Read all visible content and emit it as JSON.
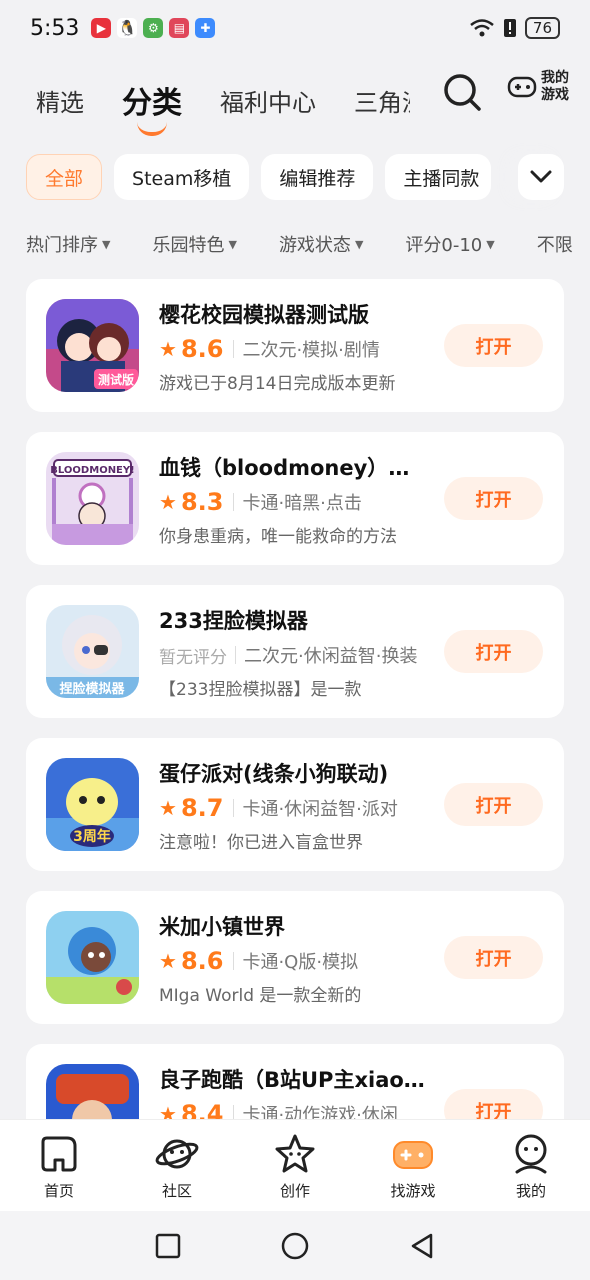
{
  "status_bar": {
    "time": "5:53",
    "battery": "76",
    "notification_icons": [
      "video-app-icon",
      "qq-icon",
      "settings-app-icon",
      "book-app-icon",
      "game-app-icon"
    ]
  },
  "top_tabs": [
    {
      "label": "精选",
      "active": false
    },
    {
      "label": "分类",
      "active": true
    },
    {
      "label": "福利中心",
      "active": false
    },
    {
      "label": "三角洲",
      "active": false
    }
  ],
  "my_games_label": "我的游戏",
  "chips": [
    {
      "label": "全部",
      "active": true
    },
    {
      "label": "Steam移植",
      "active": false
    },
    {
      "label": "编辑推荐",
      "active": false
    },
    {
      "label": "主播同款",
      "active": false
    }
  ],
  "sorts": [
    {
      "label": "热门排序"
    },
    {
      "label": "乐园特色"
    },
    {
      "label": "游戏状态"
    },
    {
      "label": "评分0-10"
    },
    {
      "label": "不限"
    }
  ],
  "games": [
    {
      "title": "樱花校园模拟器测试版",
      "score": "8.6",
      "tags": "二次元·模拟·剧情",
      "desc": "游戏已于8月14日完成版本更新",
      "button": "打开"
    },
    {
      "title": "血钱（bloodmoney）测试版",
      "score": "8.3",
      "tags": "卡通·暗黑·点击",
      "desc": "你身患重病，唯一能救命的方法",
      "button": "打开"
    },
    {
      "title": "233捏脸模拟器",
      "score": "",
      "no_score_label": "暂无评分",
      "tags": "二次元·休闲益智·换装",
      "desc": "【233捏脸模拟器】是一款",
      "button": "打开"
    },
    {
      "title": "蛋仔派对(线条小狗联动)",
      "score": "8.7",
      "tags": "卡通·休闲益智·派对",
      "desc": "注意啦！你已进入盲盒世界",
      "button": "打开"
    },
    {
      "title": "米加小镇世界",
      "score": "8.6",
      "tags": "卡通·Q版·模拟",
      "desc": "MIga World 是一款全新的",
      "button": "打开"
    },
    {
      "title": "良子跑酷（B站UP主xiaoliangzi）",
      "score": "8.4",
      "tags": "卡通·动作游戏·休闲",
      "desc": "",
      "button": "打开"
    }
  ],
  "bottom_nav": [
    {
      "label": "首页",
      "icon": "home-icon",
      "active": false
    },
    {
      "label": "社区",
      "icon": "planet-icon",
      "active": false
    },
    {
      "label": "创作",
      "icon": "star-icon",
      "active": false
    },
    {
      "label": "找游戏",
      "icon": "gamepad-icon",
      "active": true
    },
    {
      "label": "我的",
      "icon": "profile-icon",
      "active": false
    }
  ],
  "colors": {
    "accent": "#ff7a1a",
    "button_bg": "#fff1e8",
    "page_bg": "#f2f2f4"
  }
}
